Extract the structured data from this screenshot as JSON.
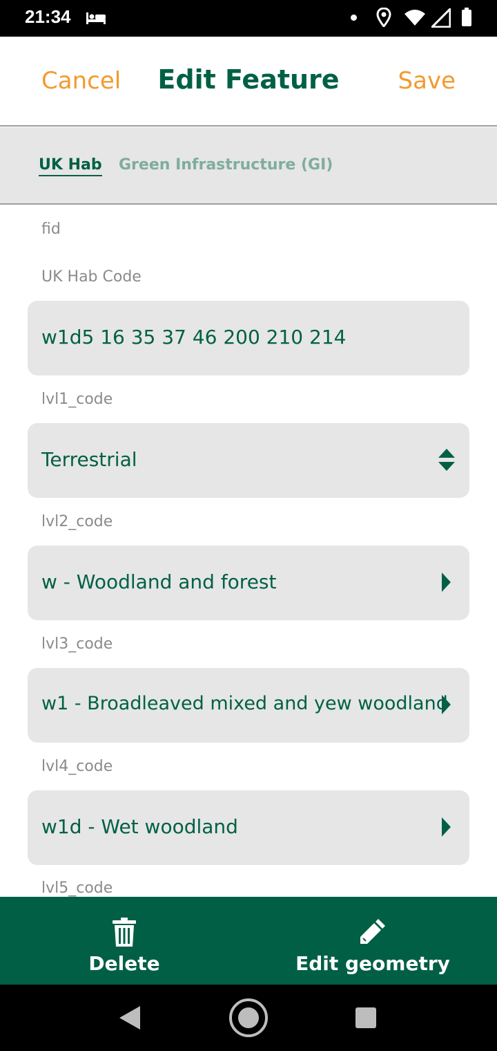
{
  "status_bar": {
    "time": "21:34",
    "icons": [
      "bed-icon",
      "notification-dot-icon",
      "location-icon",
      "wifi-icon",
      "signal-icon",
      "battery-icon"
    ]
  },
  "header": {
    "cancel_label": "Cancel",
    "title": "Edit Feature",
    "save_label": "Save"
  },
  "tabs": [
    {
      "label": "UK Hab",
      "active": true
    },
    {
      "label": "Green Infrastructure (GI)",
      "active": false
    }
  ],
  "form": {
    "fid_label": "fid",
    "uk_hab_code_label": "UK Hab Code",
    "uk_hab_code_value": "w1d5 16 35 37 46 200 210 214",
    "lvl1_label": "lvl1_code",
    "lvl1_value": "Terrestrial",
    "lvl2_label": "lvl2_code",
    "lvl2_value": "w - Woodland and forest",
    "lvl3_label": "lvl3_code",
    "lvl3_value": "w1 - Broadleaved mixed and yew woodland",
    "lvl4_label": "lvl4_code",
    "lvl4_value": "w1d - Wet woodland",
    "lvl5_label": "lvl5_code"
  },
  "actions": {
    "delete_label": "Delete",
    "edit_geometry_label": "Edit geometry"
  },
  "colors": {
    "accent_orange": "#f39a2e",
    "brand_green": "#006045",
    "action_bar": "#005f45",
    "field_bg": "#e6e6e6"
  }
}
